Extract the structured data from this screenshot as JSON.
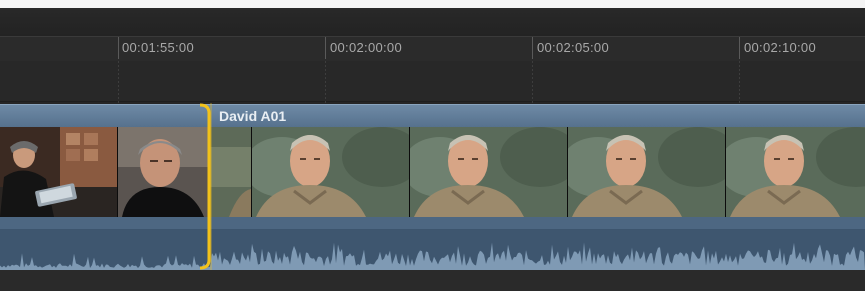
{
  "ruler": {
    "timecodes": [
      "00:01:55:00",
      "00:02:00:00",
      "00:02:05:00",
      "00:02:10:00"
    ]
  },
  "clip": {
    "name": "David A01",
    "color": "#5e7a96",
    "audio_color": "#3e566f"
  },
  "edit_point": {
    "color": "#f2c21b",
    "icon": "trim-bracket-icon"
  },
  "filmstrip": {
    "frames": [
      {
        "kind": "previous-clip",
        "description_icon": "man-with-tablet-thumbnail"
      },
      {
        "kind": "previous-clip",
        "description_icon": "man-closeup-thumbnail"
      },
      {
        "kind": "interview",
        "description_icon": "interview-thumbnail"
      },
      {
        "kind": "interview",
        "description_icon": "interview-thumbnail"
      },
      {
        "kind": "interview",
        "description_icon": "interview-thumbnail"
      },
      {
        "kind": "interview",
        "description_icon": "interview-thumbnail"
      }
    ]
  }
}
